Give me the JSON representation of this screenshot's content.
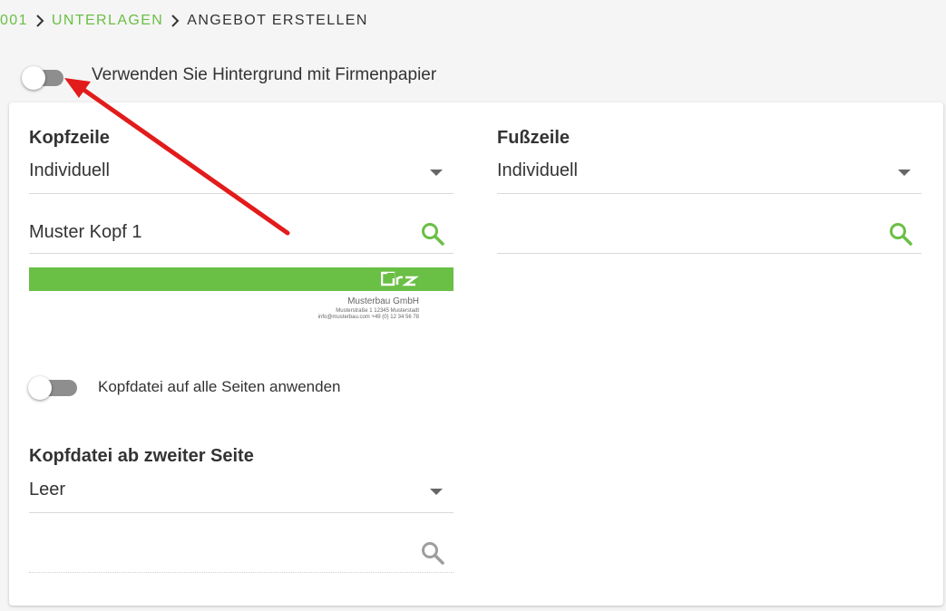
{
  "breadcrumb": {
    "items": [
      {
        "label": "001",
        "link": true
      },
      {
        "label": "UNTERLAGEN",
        "link": true
      },
      {
        "label": "ANGEBOT ERSTELLEN",
        "link": false
      }
    ]
  },
  "background_toggle": {
    "label": "Verwenden Sie Hintergrund mit Firmenpapier",
    "checked": false
  },
  "header": {
    "title": "Kopfzeile",
    "type_select": "Individuell",
    "file_field": "Muster Kopf 1",
    "preview": {
      "company": "Musterbau GmbH",
      "address": "Musterstraße 1 12345 Musterstadt",
      "contact": "info@musterbau.com +49 (0) 12 34 56 78"
    },
    "apply_all_toggle": {
      "label": "Kopfdatei auf alle Seiten anwenden",
      "checked": false
    }
  },
  "footer": {
    "title": "Fußzeile",
    "type_select": "Individuell",
    "file_field": ""
  },
  "second_page_header": {
    "title": "Kopfdatei ab zweiter Seite",
    "type_select": "Leer",
    "file_field": ""
  },
  "colors": {
    "accent": "#6abf45",
    "toggle_off": "#8e8e8e",
    "annotation_arrow": "#e21b1b",
    "disabled_icon": "#9e9e9e"
  },
  "icons": {
    "breadcrumb_separator": "chevron-right-icon",
    "search": "magnifier-icon"
  }
}
